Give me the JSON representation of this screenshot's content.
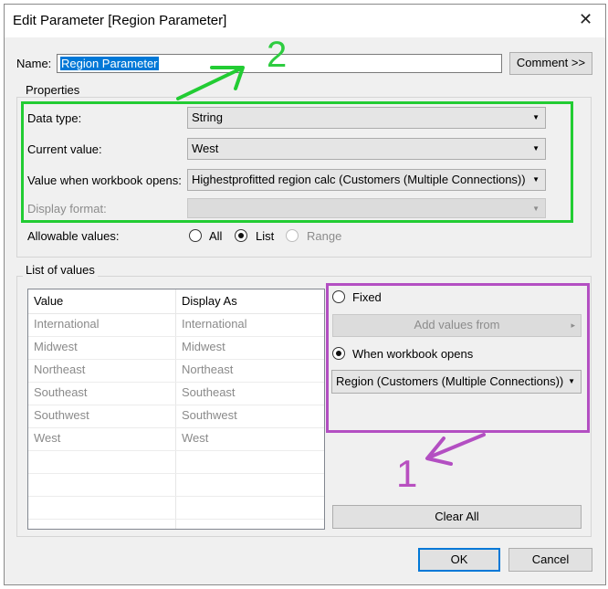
{
  "window": {
    "title": "Edit Parameter [Region Parameter]",
    "close_glyph": "✕"
  },
  "name": {
    "label": "Name:",
    "value": "Region Parameter",
    "comment_button": "Comment >>"
  },
  "properties": {
    "group_label": "Properties",
    "data_type": {
      "label": "Data type:",
      "value": "String"
    },
    "current_value": {
      "label": "Current value:",
      "value": "West"
    },
    "value_on_open": {
      "label": "Value when workbook opens:",
      "value": "Highestprofitted region calc (Customers (Multiple Connections))"
    },
    "display_format": {
      "label": "Display format:",
      "value": ""
    },
    "allowable": {
      "label": "Allowable values:",
      "options": [
        "All",
        "List",
        "Range"
      ],
      "selected": "List"
    }
  },
  "list_of_values": {
    "group_label": "List of values",
    "columns": [
      "Value",
      "Display As"
    ],
    "rows": [
      [
        "International",
        "International"
      ],
      [
        "Midwest",
        "Midwest"
      ],
      [
        "Northeast",
        "Northeast"
      ],
      [
        "Southeast",
        "Southeast"
      ],
      [
        "Southwest",
        "Southwest"
      ],
      [
        "West",
        "West"
      ]
    ],
    "fixed_label": "Fixed",
    "add_values_label": "Add values from",
    "when_opens_label": "When workbook opens",
    "source_field": "Region (Customers (Multiple Connections))",
    "clear_all": "Clear All"
  },
  "footer": {
    "ok": "OK",
    "cancel": "Cancel"
  },
  "annotations": [
    {
      "text": "1",
      "color": "#b84fc0"
    },
    {
      "text": "2",
      "color": "#2ecc40"
    }
  ],
  "colors": {
    "green_box": "#22cc33",
    "purple_box": "#b34fc2",
    "selection": "#0078d7"
  }
}
